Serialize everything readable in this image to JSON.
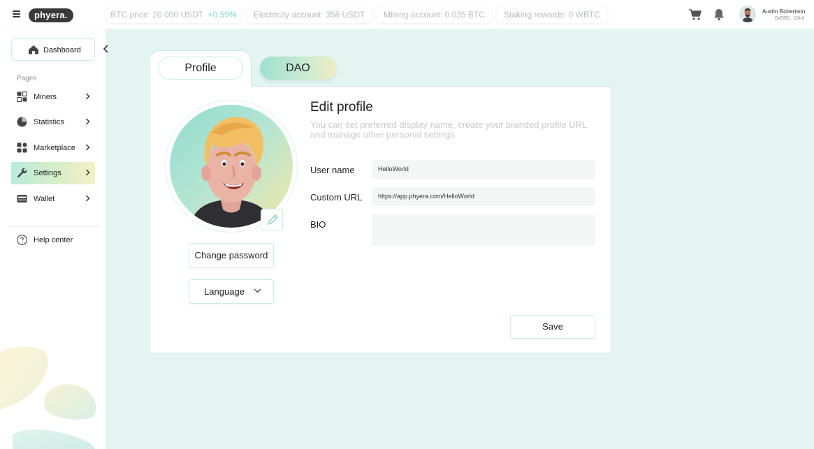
{
  "topbar": {
    "logo": "phyera.",
    "btc_price": "BTC price: 20 000 USDT",
    "btc_change": "+0.59%",
    "electricity": "Electricity account: 358 USDT",
    "mining": "Mining account: 0.035 BTC",
    "staking": "Staking rewards: 0 WBTC",
    "user_name": "Austin Robertson",
    "user_address": "0xE8D...18c4"
  },
  "sidebar": {
    "dashboard": "Dashboard",
    "pages_label": "Pages",
    "items": [
      {
        "label": "Miners"
      },
      {
        "label": "Statistics"
      },
      {
        "label": "Marketplace"
      },
      {
        "label": "Settings"
      },
      {
        "label": "Wallet"
      }
    ],
    "active_item": "Settings",
    "help": "Help center"
  },
  "tabs": {
    "profile": "Profile",
    "dao": "DAO"
  },
  "profile": {
    "change_password": "Change password",
    "language": "Language",
    "title": "Edit profile",
    "description": "You can set preferred display name, create your branded profile URL and manage other personal settings",
    "username_label": "User name",
    "username_value": "HelloWorld",
    "url_label": "Custom URL",
    "url_value": "https://app.phyera.com/HelloWorld",
    "bio_label": "BIO",
    "bio_value": "",
    "save": "Save"
  },
  "colors": {
    "accent": "#7fd6c8",
    "background": "#e3f4f1",
    "border": "#c9ece4"
  }
}
